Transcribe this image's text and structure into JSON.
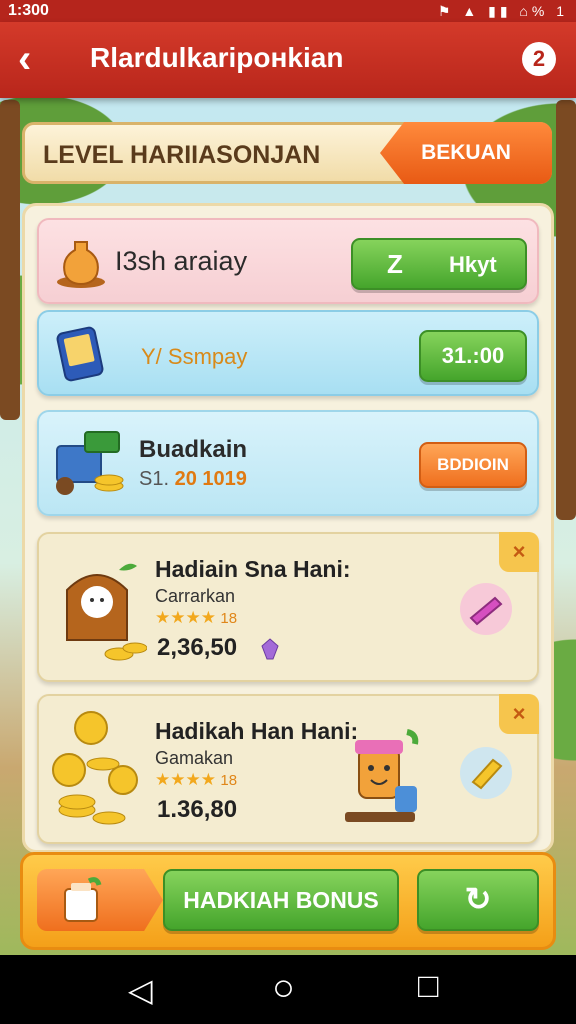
{
  "status_bar": {
    "time": "1:300",
    "icons": "⚑ ▲ ▮▮ ⌂% 1"
  },
  "header": {
    "back_label": "‹",
    "title": "Rlardulkaripонkian",
    "help_label": "2"
  },
  "level_bar": {
    "title": "LEVEL HARIIASONJAN",
    "button_label": "BEKUAN"
  },
  "cards": [
    {
      "title": "I3sh araiay",
      "button_label": "Hkyt",
      "button_badge": "Z"
    },
    {
      "title": "Y/ Ssmpay",
      "button_label": "31.:00"
    },
    {
      "title": "Buadkain",
      "subtitle_prefix": "S1.",
      "subtitle_value": "20 1019",
      "button_label": "BDDIOIN"
    }
  ],
  "rewards": [
    {
      "title": "Hadiain Sna Hani:",
      "subtitle": "Carrarkan",
      "stars": "★★★★",
      "rating": "18",
      "amount": "2,36,50",
      "close_label": "×"
    },
    {
      "title": "Hadikah Han Hani:",
      "subtitle": "Gamakan",
      "stars": "★★★★",
      "rating": "18",
      "amount": "1.36,80",
      "close_label": "×"
    }
  ],
  "bottom_bar": {
    "bonus_label": "HADKIAH BONUS",
    "refresh_label": "↻"
  },
  "nav": {
    "back": "◁",
    "home": "○",
    "recent": "□"
  }
}
